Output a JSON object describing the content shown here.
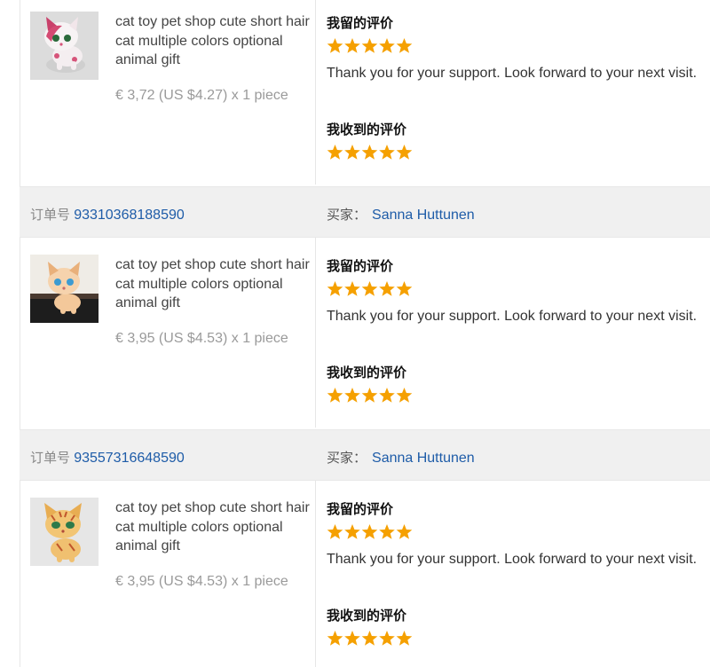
{
  "colors": {
    "link": "#1e5ca8",
    "star": "#f5a000",
    "header_bg": "#f0f0f0"
  },
  "orders": [
    {
      "order_label": "",
      "order_number": "",
      "buyer_label": "",
      "buyer_name": "",
      "thumb": "pink-white-cat-toy-photo",
      "item_title": "cat toy pet shop cute short hair cat multiple colors optional animal gift",
      "item_price": "€ 3,72 (US $4.27) x 1 piece",
      "left_review_heading": "我留的评价",
      "left_review_stars": 5,
      "left_review_text": "Thank you for your support. Look forward to your next visit.",
      "received_review_heading": "我收到的评价",
      "received_review_stars": 5
    },
    {
      "order_label": "订单号",
      "order_number": "93310368188590",
      "buyer_label": "买家：",
      "buyer_name": "Sanna Huttunen",
      "thumb": "orange-cat-toy-photo",
      "item_title": "cat toy pet shop cute short hair cat multiple colors optional animal gift",
      "item_price": "€ 3,95 (US $4.53) x 1 piece",
      "left_review_heading": "我留的评价",
      "left_review_stars": 5,
      "left_review_text": "Thank you for your support. Look forward to your next visit.",
      "received_review_heading": "我收到的评价",
      "received_review_stars": 5
    },
    {
      "order_label": "订单号",
      "order_number": "93557316648590",
      "buyer_label": "买家：",
      "buyer_name": "Sanna Huttunen",
      "thumb": "tabby-cat-toy-photo",
      "item_title": "cat toy pet shop cute short hair cat multiple colors optional animal gift",
      "item_price": "€ 3,95 (US $4.53) x 1 piece",
      "left_review_heading": "我留的评价",
      "left_review_stars": 5,
      "left_review_text": "Thank you for your support. Look forward to your next visit.",
      "received_review_heading": "我收到的评价",
      "received_review_stars": 5
    }
  ]
}
